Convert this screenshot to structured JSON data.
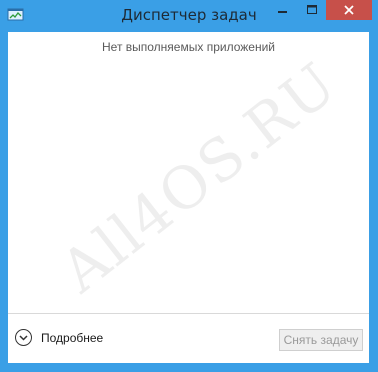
{
  "window": {
    "title": "Диспетчер задач",
    "accent_color": "#3a9fe6",
    "close_color": "#c7504a"
  },
  "main": {
    "empty_message": "Нет выполняемых приложений"
  },
  "footer": {
    "more_details_label": "Подробнее",
    "end_task_label": "Снять задачу"
  },
  "watermark": {
    "text": "All4OS.RU"
  },
  "icons": {
    "app": "task-manager-icon",
    "minimize": "minimize-icon",
    "maximize": "maximize-icon",
    "close": "close-icon",
    "expand": "chevron-down-icon"
  }
}
